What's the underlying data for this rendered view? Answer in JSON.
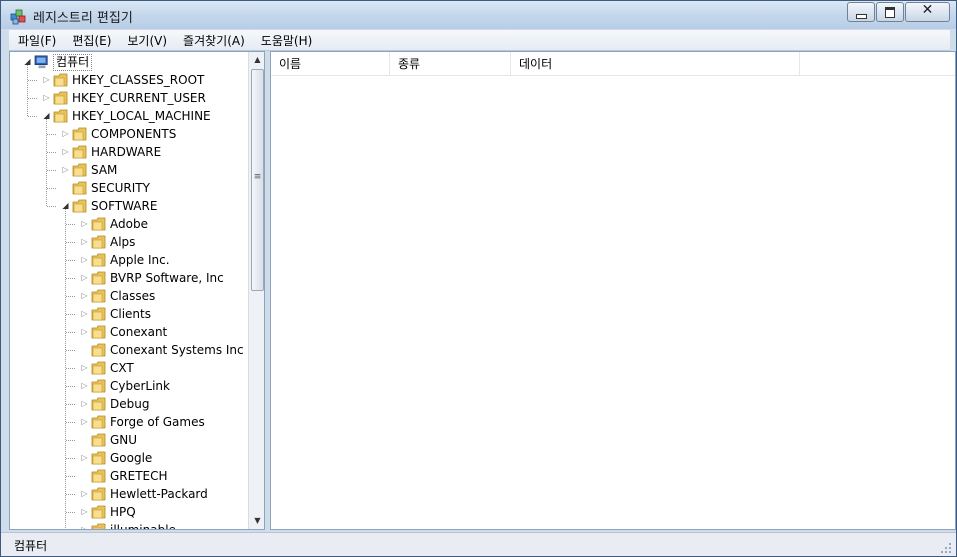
{
  "window": {
    "title": "레지스트리 편집기"
  },
  "menu": [
    "파일(F)",
    "편집(E)",
    "보기(V)",
    "즐겨찾기(A)",
    "도움말(H)"
  ],
  "tree": [
    {
      "label": "컴퓨터",
      "icon": "computer-icon",
      "expander": "expanded"
    },
    {
      "label": "HKEY_CLASSES_ROOT",
      "icon": "folder-icon",
      "expander": "collapsed"
    },
    {
      "label": "HKEY_CURRENT_USER",
      "icon": "folder-icon",
      "expander": "collapsed"
    },
    {
      "label": "HKEY_LOCAL_MACHINE",
      "icon": "folder-icon",
      "expander": "expanded"
    },
    {
      "label": "COMPONENTS",
      "icon": "folder-icon",
      "expander": "collapsed"
    },
    {
      "label": "HARDWARE",
      "icon": "folder-icon",
      "expander": "collapsed"
    },
    {
      "label": "SAM",
      "icon": "folder-icon",
      "expander": "collapsed"
    },
    {
      "label": "SECURITY",
      "icon": "folder-icon",
      "expander": "none"
    },
    {
      "label": "SOFTWARE",
      "icon": "folder-icon",
      "expander": "expanded"
    },
    {
      "label": "Adobe",
      "icon": "folder-icon",
      "expander": "collapsed"
    },
    {
      "label": "Alps",
      "icon": "folder-icon",
      "expander": "collapsed"
    },
    {
      "label": "Apple Inc.",
      "icon": "folder-icon",
      "expander": "collapsed"
    },
    {
      "label": "BVRP Software, Inc",
      "icon": "folder-icon",
      "expander": "collapsed"
    },
    {
      "label": "Classes",
      "icon": "folder-icon",
      "expander": "collapsed"
    },
    {
      "label": "Clients",
      "icon": "folder-icon",
      "expander": "collapsed"
    },
    {
      "label": "Conexant",
      "icon": "folder-icon",
      "expander": "collapsed"
    },
    {
      "label": "Conexant Systems Inc",
      "icon": "folder-icon",
      "expander": "none"
    },
    {
      "label": "CXT",
      "icon": "folder-icon",
      "expander": "collapsed"
    },
    {
      "label": "CyberLink",
      "icon": "folder-icon",
      "expander": "collapsed"
    },
    {
      "label": "Debug",
      "icon": "folder-icon",
      "expander": "collapsed"
    },
    {
      "label": "Forge of Games",
      "icon": "folder-icon",
      "expander": "collapsed"
    },
    {
      "label": "GNU",
      "icon": "folder-icon",
      "expander": "none"
    },
    {
      "label": "Google",
      "icon": "folder-icon",
      "expander": "collapsed"
    },
    {
      "label": "GRETECH",
      "icon": "folder-icon",
      "expander": "none"
    },
    {
      "label": "Hewlett-Packard",
      "icon": "folder-icon",
      "expander": "collapsed"
    },
    {
      "label": "HPQ",
      "icon": "folder-icon",
      "expander": "collapsed"
    },
    {
      "label": "illuminable",
      "icon": "folder-icon",
      "expander": "collapsed"
    }
  ],
  "columns": [
    "이름",
    "종류",
    "데이터"
  ],
  "status": "컴퓨터",
  "colors": {
    "folder": "#e8c25a",
    "window_frame": "#cfdcea",
    "selection_border": "#888888"
  }
}
